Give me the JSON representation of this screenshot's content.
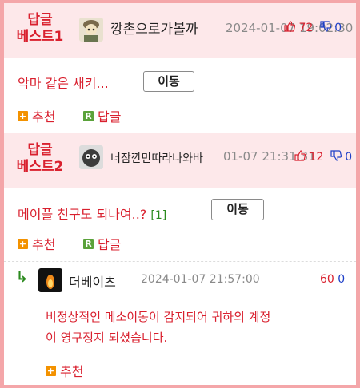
{
  "best1": {
    "label_line1": "답글",
    "label_line2": "베스트1",
    "nick": "깡촌으로가볼까",
    "timestamp": "2024-01-07 19:02:30",
    "up": "72",
    "down": "0",
    "text": "악마 같은 새키...",
    "move_label": "이동",
    "recommend_label": "추천",
    "reply_label": "답글"
  },
  "best2": {
    "label_line1": "답글",
    "label_line2": "베스트2",
    "nick": "너잠깐만따라나와바",
    "timestamp": "01-07 21:31:31",
    "up": "12",
    "down": "0",
    "text": "메이플 친구도 되나여..?",
    "reply_count": "[1]",
    "move_label": "이동",
    "recommend_label": "추천",
    "reply_label": "답글"
  },
  "reply": {
    "nick": "더베이츠",
    "timestamp": "2024-01-07 21:57:00",
    "up": "60",
    "down": "0",
    "text_line1": "비정상적인 메소이동이 감지되어 귀하의 계정",
    "text_line2": "이 영구정지 되셨습니다.",
    "recommend_label": "추천"
  },
  "icons": {
    "plus_square": "+",
    "r_square": "R",
    "reply_arrow": "↳"
  },
  "colors": {
    "border": "#f4a6a9",
    "best_bg": "#fde8ea",
    "accent_red": "#d9202e",
    "down_blue": "#1e3fc8",
    "plus_orange": "#f39200",
    "reply_green": "#5aa23a"
  }
}
